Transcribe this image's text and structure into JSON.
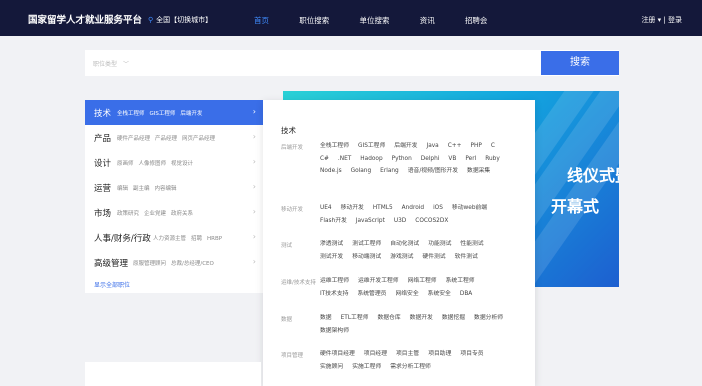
{
  "nav": {
    "brand": "国家留学人才就业服务平台",
    "city": "全国【切换城市】",
    "links": [
      "首页",
      "职位搜索",
      "单位搜索",
      "资讯",
      "招聘会"
    ],
    "auth": "注册 ▾ | 登录"
  },
  "search": {
    "type_placeholder": "职位类型",
    "button": "搜索"
  },
  "categories": [
    {
      "label": "技术",
      "subs": [
        "全栈工程师",
        "GIS工程师",
        "后端开发"
      ]
    },
    {
      "label": "产品",
      "subs": [
        "硬件产品经理",
        "产品经理",
        "网页产品经理"
      ]
    },
    {
      "label": "设计",
      "subs": [
        "原画师",
        "人像修图师",
        "视觉设计"
      ]
    },
    {
      "label": "运营",
      "subs": [
        "编辑",
        "副主编",
        "内容编辑"
      ]
    },
    {
      "label": "市场",
      "subs": [
        "政策研究",
        "企业党建",
        "政府关系"
      ]
    },
    {
      "label": "人事/财务/行政",
      "subs": [
        "人力资源主管",
        "招聘",
        "HRBP"
      ]
    },
    {
      "label": "高级管理",
      "subs": [
        "原服管理顾问",
        "总裁/总经理/CEO"
      ]
    }
  ],
  "show_all": "显示全部职位",
  "banner": {
    "line1": "线仪式暨",
    "line2": "开幕式"
  },
  "panel": {
    "title": "技术",
    "groups": [
      {
        "label": "后端开发",
        "items": [
          "全栈工程师",
          "GIS工程师",
          "后端开发",
          "Java",
          "C++",
          "PHP",
          "C",
          "C#",
          ".NET",
          "Hadoop",
          "Python",
          "Delphi",
          "VB",
          "Perl",
          "Ruby",
          "Node.js",
          "Golang",
          "Erlang",
          "语音/视频/图形开发",
          "数据采集"
        ]
      },
      {
        "label": "移动开发",
        "items": [
          "UE4",
          "移动开发",
          "HTML5",
          "Android",
          "iOS",
          "移动web前端",
          "Flash开发",
          "JavaScript",
          "U3D",
          "COCOS2DX"
        ]
      },
      {
        "label": "测试",
        "items": [
          "渗透测试",
          "测试工程师",
          "自动化测试",
          "功能测试",
          "性能测试",
          "测试开发",
          "移动端测试",
          "游戏测试",
          "硬件测试",
          "软件测试"
        ]
      },
      {
        "label": "运维/技术支持",
        "items": [
          "运维工程师",
          "运维开发工程师",
          "网络工程师",
          "系统工程师",
          "IT技术支持",
          "系统管理员",
          "网络安全",
          "系统安全",
          "DBA"
        ]
      },
      {
        "label": "数据",
        "items": [
          "数据",
          "ETL工程师",
          "数据仓库",
          "数据开发",
          "数据挖掘",
          "数据分析师",
          "数据架构师"
        ]
      },
      {
        "label": "项目管理",
        "items": [
          "硬件项目经理",
          "项目经理",
          "项目主管",
          "项目助理",
          "项目专员",
          "实施顾问",
          "实施工程师",
          "需求分析工程师"
        ]
      }
    ]
  },
  "colors": {
    "nav_bg": "#14183a",
    "accent": "#3a6ee8",
    "active_nav_link": "#3f8cff"
  }
}
